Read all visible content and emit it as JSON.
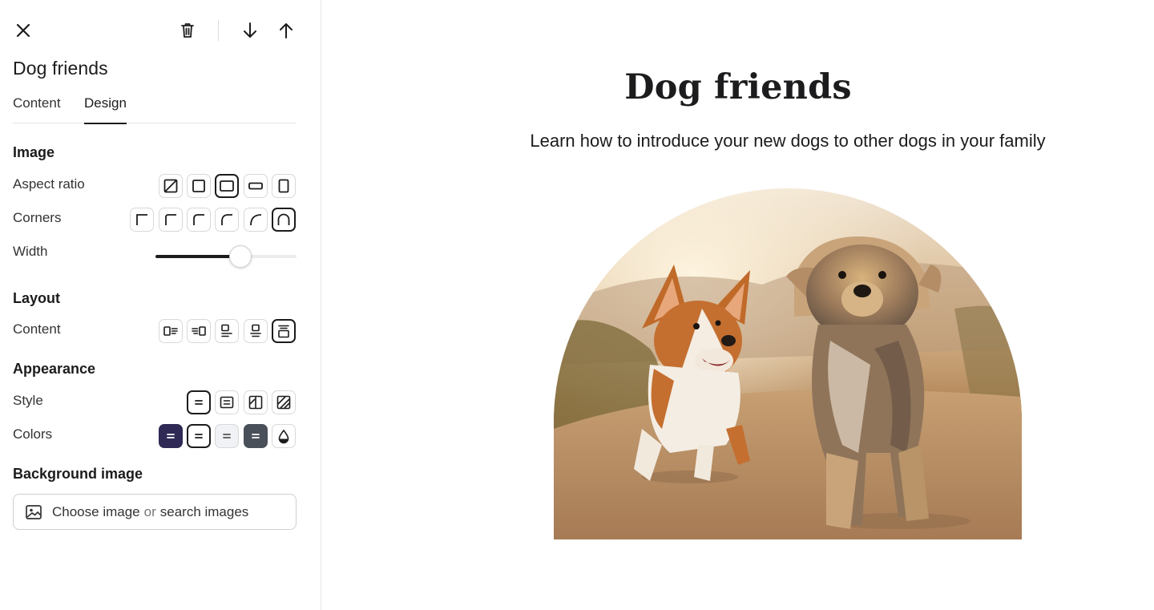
{
  "toolbar": {
    "close_icon": "close-icon",
    "delete_icon": "trash-icon",
    "move_down_icon": "arrow-down-icon",
    "move_up_icon": "arrow-up-icon"
  },
  "panel": {
    "title": "Dog friends",
    "tabs": [
      {
        "label": "Content",
        "active": false
      },
      {
        "label": "Design",
        "active": true
      }
    ]
  },
  "image_section": {
    "title": "Image",
    "aspect_ratio_label": "Aspect ratio",
    "aspect_ratio_selected": 3,
    "corners_label": "Corners",
    "corners_selected": 6,
    "width_label": "Width",
    "width_value": 0.6
  },
  "layout_section": {
    "title": "Layout",
    "content_label": "Content",
    "content_selected": 5
  },
  "appearance_section": {
    "title": "Appearance",
    "style_label": "Style",
    "style_selected": 1,
    "colors_label": "Colors",
    "colors_selected": 2,
    "color_swatches": [
      "#2e2a55",
      "#ffffff",
      "#f1f2f6",
      "#4a5059",
      "#ffffff"
    ]
  },
  "background_section": {
    "title": "Background image",
    "button_choose": "Choose image",
    "button_or": "or",
    "button_search": "search images",
    "icon": "image-icon"
  },
  "preview": {
    "title": "Dog friends",
    "subtitle": "Learn how to introduce your new dogs to other dogs in your family",
    "image_alt": "Corgi and Yorkshire terrier running on a dirt path at sunset"
  },
  "colors": {
    "text": "#1c1c1e",
    "border": "#d8d8d8",
    "accent_dark": "#2e2a55"
  }
}
